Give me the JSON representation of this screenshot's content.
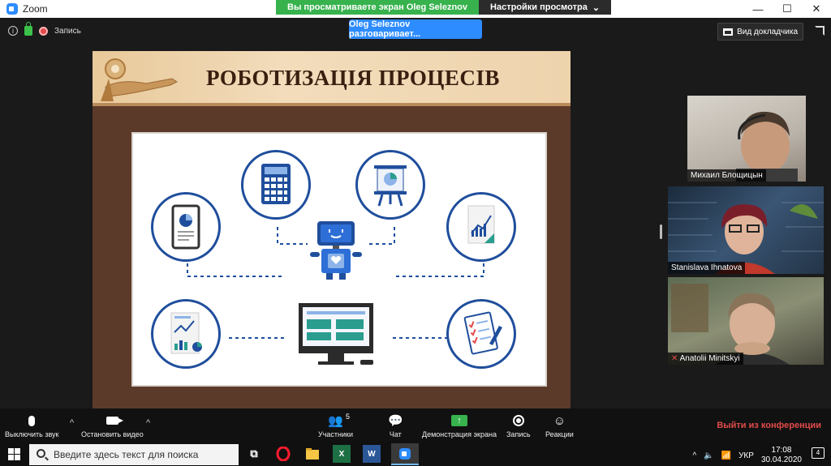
{
  "window": {
    "title": "Zoom",
    "controls": [
      "—",
      "☐",
      "✕"
    ]
  },
  "share_banner": {
    "viewing_text": "Вы просматриваете экран Oleg Seleznov",
    "view_options": "Настройки просмотра"
  },
  "meeting_top": {
    "recording_label": "Запись",
    "active_speaker": "Oleg Seleznov разговаривает...",
    "view_button": "Вид докладчика"
  },
  "slide": {
    "title": "РОБОТИЗАЦІЯ ПРОЦЕСІВ"
  },
  "participants": [
    {
      "name": "Михаил Блощицын"
    },
    {
      "name": "Stanislava Ihnatova"
    },
    {
      "name": "Anatolii Minitskyi",
      "muted": true
    }
  ],
  "toolbar": {
    "mute_label": "Выключить звук",
    "video_label": "Остановить видео",
    "participants_label": "Участники",
    "participants_count": "5",
    "chat_label": "Чат",
    "share_label": "Демонстрация экрана",
    "record_label": "Запись",
    "reactions_label": "Реакции",
    "leave_label": "Выйти из конференции"
  },
  "taskbar": {
    "search_placeholder": "Введите здесь текст для поиска",
    "language": "УКР",
    "time": "17:08",
    "date": "30.04.2020",
    "notifications": "4"
  },
  "colors": {
    "zoom_blue": "#2d8cff",
    "share_green": "#37b24d",
    "leave_red": "#e34b4b",
    "slide_frame": "#5c3a2a",
    "icon_blue": "#1f4e9c"
  }
}
